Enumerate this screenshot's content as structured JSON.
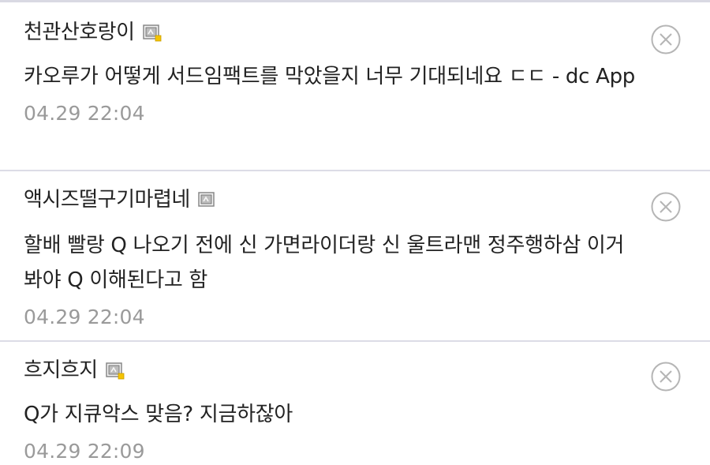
{
  "comments": [
    {
      "nickname": "천관산호랑이",
      "user_icon": "gallog-icon-fixed",
      "text": "카오루가 어떻게 서드임팩트를 막았을지 너무 기대되네요 ㄷㄷ - dc App",
      "timestamp": "04.29 22:04",
      "delete_icon": "circle-x-icon"
    },
    {
      "nickname": "액시즈떨구기마렵네",
      "user_icon": "gallog-icon-fluid",
      "text": "할배 빨랑 Q 나오기 전에 신 가면라이더랑 신 울트라맨 정주행하삼 이거 봐야 Q 이해된다고 함",
      "timestamp": "04.29 22:04",
      "delete_icon": "circle-x-icon"
    },
    {
      "nickname": "흐지흐지",
      "user_icon": "gallog-icon-fixed",
      "text": "Q가 지큐악스 맞음? 지금하잖아",
      "timestamp": "04.29 22:09",
      "delete_icon": "circle-x-icon"
    }
  ],
  "colors": {
    "text": "#222222",
    "timestamp": "#9a9a9a",
    "divider": "#dcdce6",
    "icon_badge": "#f5c400"
  }
}
